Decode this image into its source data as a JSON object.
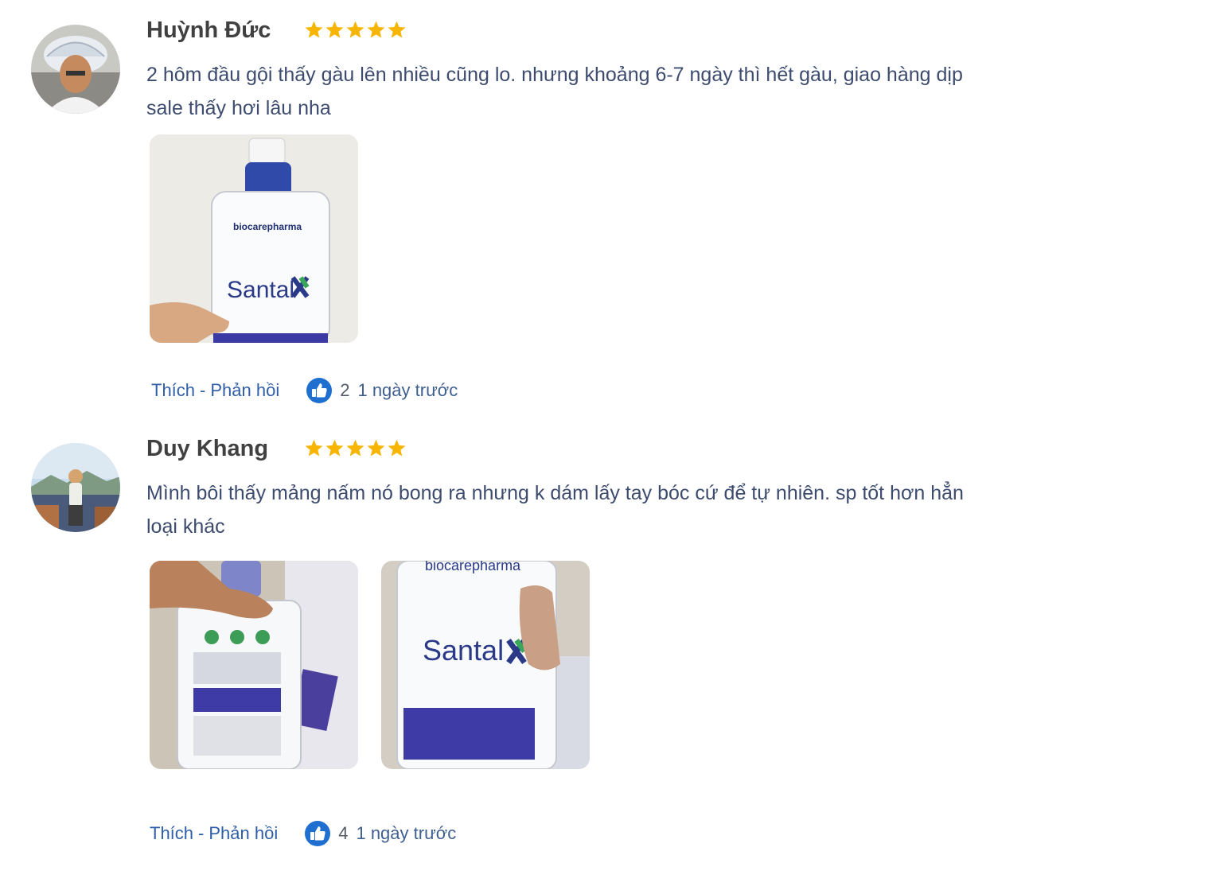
{
  "colors": {
    "star": "#f7b500",
    "link": "#2f5ea8",
    "name": "#404040",
    "text": "#3c4b6e",
    "like": "#1f6fd0"
  },
  "reviews": [
    {
      "name": "Huỳnh Đức",
      "rating": 5,
      "text": "2 hôm đầu gội thấy gàu lên nhiều cũng lo. nhưng khoảng 6-7 ngày thì hết gàu, giao hàng dịp sale thấy hơi lâu nha",
      "photos": [
        {
          "brand": "biocarepharma",
          "product": "Santal"
        }
      ],
      "like_label": "Thích",
      "separator": "-",
      "reply_label": "Phản hồi",
      "like_icon": "thumbs-up-icon",
      "like_count": "2",
      "time": "1 ngày trước"
    },
    {
      "name": "Duy Khang",
      "rating": 5,
      "text": "Mình bôi thấy mảng nấm nó bong ra nhưng k dám lấy tay bóc cứ để tự nhiên. sp tốt hơn hẳn loại khác",
      "photos": [
        {
          "brand": "",
          "product": ""
        },
        {
          "brand": "biocarepharma",
          "product": "Santal"
        }
      ],
      "like_label": "Thích",
      "separator": "-",
      "reply_label": "Phản hồi",
      "like_icon": "thumbs-up-icon",
      "like_count": "4",
      "time": "1 ngày trước"
    }
  ]
}
